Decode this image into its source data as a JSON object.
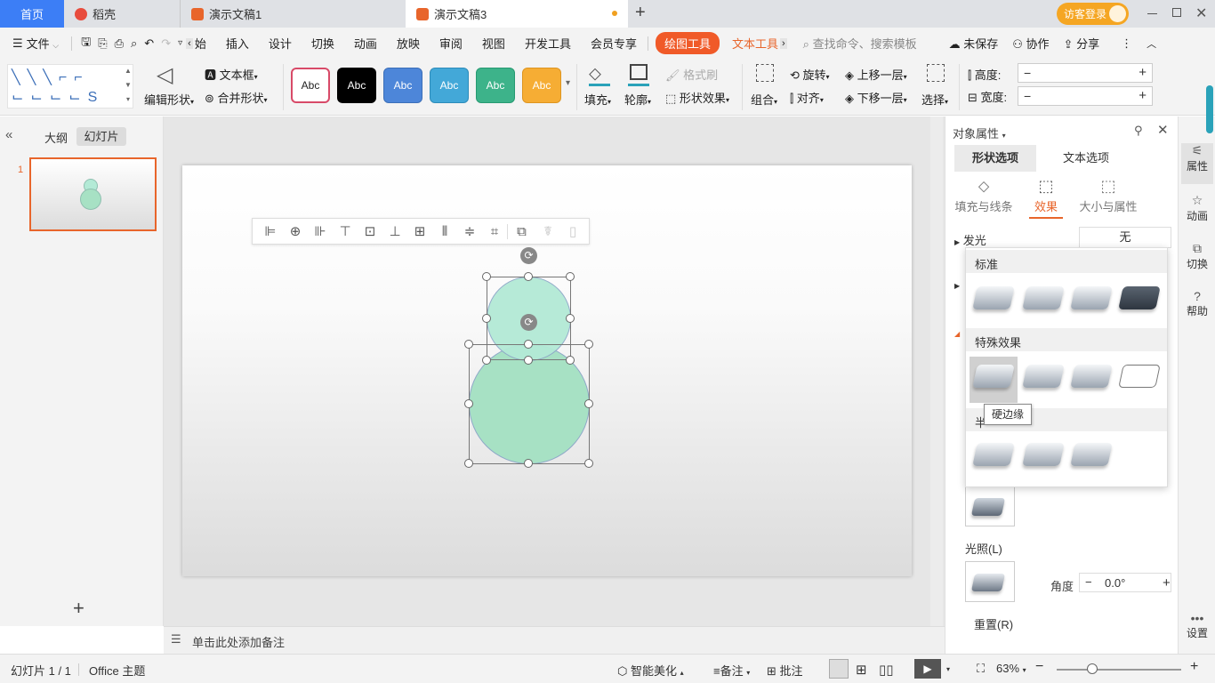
{
  "tabs": {
    "home": "首页",
    "daoke": "稻壳",
    "doc1": "演示文稿1",
    "doc3": "演示文稿3",
    "add": "+",
    "visitor": "访客登录"
  },
  "menu": {
    "file": "文件",
    "items": [
      "始",
      "插入",
      "设计",
      "切换",
      "动画",
      "放映",
      "审阅",
      "视图",
      "开发工具",
      "会员专享"
    ],
    "draw_tool": "绘图工具",
    "text_tool": "文本工具",
    "search": "查找命令、搜索模板",
    "unsaved": "未保存",
    "collab": "协作",
    "share": "分享"
  },
  "ribbon": {
    "edit_shape": "编辑形状",
    "textbox": "文本框",
    "merge_shape": "合并形状",
    "style_label": "Abc",
    "fill": "填充",
    "outline": "轮廓",
    "format_brush": "格式刷",
    "shape_effect": "形状效果",
    "group": "组合",
    "rotate": "旋转",
    "align": "对齐",
    "up_layer": "上移一层",
    "down_layer": "下移一层",
    "select": "选择",
    "height": "高度:",
    "width": "宽度:",
    "minus": "−",
    "plus": "+"
  },
  "left": {
    "outline": "大纲",
    "slides": "幻灯片",
    "slide_num": "1",
    "add": "+"
  },
  "notes": "单击此处添加备注",
  "panel": {
    "title": "对象属性",
    "tab_shape": "形状选项",
    "tab_text": "文本选项",
    "sub_fill": "填充与线条",
    "sub_effect": "效果",
    "sub_size": "大小与属性",
    "glow": "发光",
    "glow_val": "无",
    "cat_standard": "标准",
    "cat_special": "特殊效果",
    "cat_half": "半",
    "tooltip": "硬边缘",
    "light": "光照(L)",
    "angle": "角度",
    "angle_val": "0.0°",
    "reset": "重置(R)"
  },
  "rightbar": {
    "props": "属性",
    "anim": "动画",
    "switch": "切换",
    "help": "帮助",
    "settings": "设置"
  },
  "status": {
    "slide": "幻灯片 1 / 1",
    "theme": "Office 主题",
    "beautify": "智能美化",
    "notes": "备注",
    "comment": "批注",
    "zoom": "63%"
  },
  "colors": {
    "accent": "#e8652b",
    "circle_small": "#b3ead6",
    "circle_big": "#a7e1c4",
    "teal": "#2aa2b9"
  }
}
